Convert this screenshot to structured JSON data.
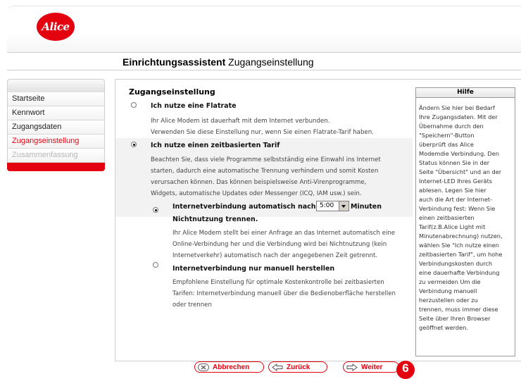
{
  "brand": {
    "logo_text": "Alice",
    "accent": "#e3000f"
  },
  "header": {
    "title_bold": "Einrichtungsassistent",
    "title_rest": " Zugangseinstellung"
  },
  "sidebar": {
    "items": [
      {
        "label": "Startseite",
        "state": "normal"
      },
      {
        "label": "Kennwort",
        "state": "normal"
      },
      {
        "label": "Zugangsdaten",
        "state": "normal"
      },
      {
        "label": "Zugangseinstellung",
        "state": "active"
      },
      {
        "label": "Zusammenfassung",
        "state": "disabled"
      }
    ]
  },
  "main": {
    "section_title": "Zugangseinstellung",
    "flatrate": {
      "label": "Ich nutze eine Flatrate",
      "selected": false,
      "lines": [
        "Ihr Alice Modem ist dauerhaft mit dem Internet verbunden.",
        "Verwenden Sie diese Einstellung nur, wenn Sie einen Flatrate-Tarif haben."
      ]
    },
    "timebased": {
      "label": "Ich nutze einen zeitbasierten Tarif",
      "selected": true,
      "lines": [
        "Beachten Sie, dass viele Programme selbstständig eine Einwahl ins Internet",
        "starten, dadurch eine automatische Trennung verhindern und somit Kosten",
        "verursachen können. Das können beispielsweise Anti-Virenprogramme,",
        "Widgets, automatische Updates oder Messenger (ICQ, IAM usw.) sein."
      ]
    },
    "auto": {
      "label_before": "Internetverbindung automatisch nach",
      "select_value": "5:00",
      "label_after": "Minuten",
      "label_line2": "Nichtnutzung trennen.",
      "selected": true,
      "lines": [
        "Ihr Alice Modem stellt bei einer Anfrage an das Internet automatisch eine",
        "Online-Verbindung her und die Verbindung wird bei Nichtnutzung (kein",
        "Internetverkehr) automatisch nach der angegebenen Zeit getrennt."
      ]
    },
    "manual": {
      "label": "Internetverbindung nur manuell herstellen",
      "selected": false,
      "lines": [
        "Empfohlene Einstellung für optimale Kostenkontrolle bei zeitbasierten",
        "Tarifen: Internetverbindung manuell über die Bedienoberfläche herstellen",
        "oder trennen"
      ]
    }
  },
  "help": {
    "title": "Hilfe",
    "lines": [
      "Ändern Sie hier bei Bedarf",
      "Ihre Zugangsdaten. Mit der",
      "Übernahme durch den",
      "\"Speichern\"-Button",
      "überprüft das Alice",
      "Modemdie Verbindung. Den",
      "Status können Sie in der",
      "Seite \"Übersicht\" und an der",
      "Internet-LED Ihres Geräts",
      "ablesen. Legen Sie hier",
      "auch die Art der Internet-",
      "Verbindung fest: Wenn Sie",
      "einen zeitbasierten",
      "Tarif(z.B.Alice Light mit",
      "Minutenabrechnung) nutzen,",
      "wählen Sie \"Ich nutze einen",
      "zeitbasierten Tarif\", um hohe",
      "Verbindungskosten durch",
      "eine dauerhafte Verbindung",
      "zu vermeiden Um die",
      "Verbindung manuell",
      "herzustellen oder zu",
      "trennen, muss immer diese",
      "Seite über Ihren Browser",
      "geöffnet werden."
    ]
  },
  "buttons": {
    "cancel": "Abbrechen",
    "back": "Zurück",
    "next": "Weiter"
  },
  "badge": "6"
}
